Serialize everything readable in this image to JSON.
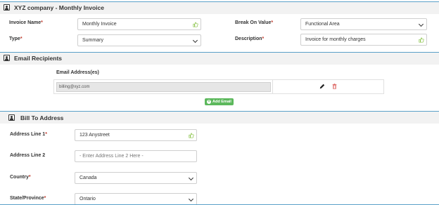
{
  "invoice_section": {
    "title": "XYZ company - Monthly Invoice",
    "fields": {
      "invoice_name": {
        "label": "Invoice Name",
        "required": "*",
        "value": "Monthly Invoice"
      },
      "break_on_value": {
        "label": "Break On Value",
        "required": "*",
        "value": "Functional Area"
      },
      "type": {
        "label": "Type",
        "required": "*",
        "value": "Summary"
      },
      "description": {
        "label": "Description",
        "required": "*",
        "value": "Invoice for monthly charges"
      }
    }
  },
  "email_section": {
    "title": "Email Recipients",
    "column_header": "Email Address(es)",
    "rows": [
      {
        "email": "billing@xyz.com"
      }
    ],
    "add_button_label": "Add Email"
  },
  "bill_section": {
    "title": "Bill To Address",
    "fields": {
      "address1": {
        "label": "Address Line 1",
        "required": "*",
        "value": "123 Anystreet"
      },
      "address2": {
        "label": "Address Line 2",
        "placeholder": "- Enter Address Line 2 Here -"
      },
      "country": {
        "label": "Country",
        "required": "*",
        "value": "Canada"
      },
      "state": {
        "label": "State/Province",
        "required": "*",
        "value": "Ontario"
      }
    }
  },
  "colors": {
    "accent_line": "#5aa0c8",
    "required": "#c0392b",
    "add_button": "#5cb85c",
    "thumb_icon": "#8bc34a",
    "delete_icon": "#d9534f"
  }
}
